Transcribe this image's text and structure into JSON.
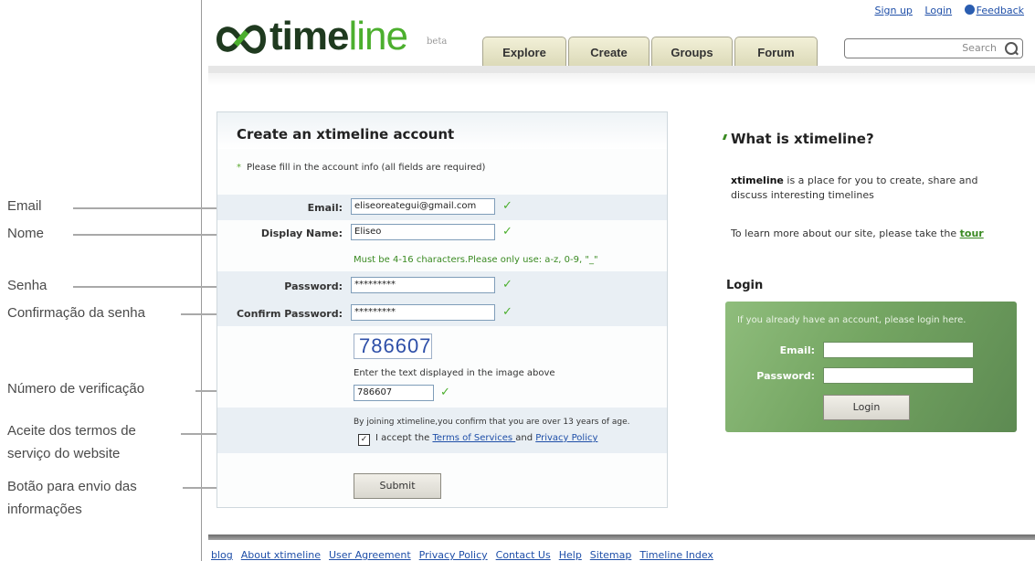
{
  "annotations": {
    "email": "Email",
    "nome": "Nome",
    "senha": "Senha",
    "confirmacao": "Confirmação da senha",
    "verificacao": "Número de verificação",
    "termos_l1": "Aceite dos termos de",
    "termos_l2": "serviço do website",
    "botao_l1": "Botão para envio das",
    "botao_l2": "informações"
  },
  "header": {
    "logo_bold": "time",
    "logo_light": "line",
    "beta": "beta",
    "top_links": {
      "signup": "Sign up",
      "login": "Login",
      "feedback": "Feedback"
    },
    "tabs": [
      "Explore",
      "Create",
      "Groups",
      "Forum"
    ],
    "search_placeholder": "Search"
  },
  "form": {
    "title": "Create an xtimeline account",
    "hint": "Please fill in the account info (all fields are required)",
    "email_label": "Email:",
    "email_value": "eliseoreategui@gmail.com",
    "display_label": "Display Name:",
    "display_value": "Eliseo",
    "display_note": "Must be 4-16 characters.Please only use: a-z, 0-9, \"_\"",
    "password_label": "Password:",
    "password_value": "*********",
    "confirm_label": "Confirm Password:",
    "confirm_value": "*********",
    "captcha_text": "786607",
    "captcha_instruction": "Enter the text displayed in the image above",
    "captcha_value": "786607",
    "age_notice": "By joining xtimeline,you confirm that you are over 13 years of age.",
    "accept_prefix": "I accept the ",
    "terms_link": "Terms of Services ",
    "accept_and": "and ",
    "privacy_link": "Privacy Policy",
    "submit_label": "Submit",
    "check_mark": "✓"
  },
  "sidebar": {
    "what_title": "What is xtimeline?",
    "desc_bold": "xtimeline",
    "desc_rest_1": " is a place for you to create, share and",
    "desc_line_2": "discuss interesting timelines",
    "tour_prefix": "To learn more about our site, please take the ",
    "tour_link": "tour",
    "login_title": "Login",
    "login_msg": "If you already have an account, please login here.",
    "email_label": "Email:",
    "password_label": "Password:",
    "login_button": "Login"
  },
  "footer": {
    "links": [
      "blog",
      "About xtimeline",
      "User Agreement",
      "Privacy Policy",
      "Contact Us",
      "Help",
      "Sitemap",
      "Timeline Index"
    ]
  },
  "colors": {
    "accent_green": "#4caf2e",
    "link_blue": "#1f4fa8",
    "login_panel": "#74a562"
  }
}
